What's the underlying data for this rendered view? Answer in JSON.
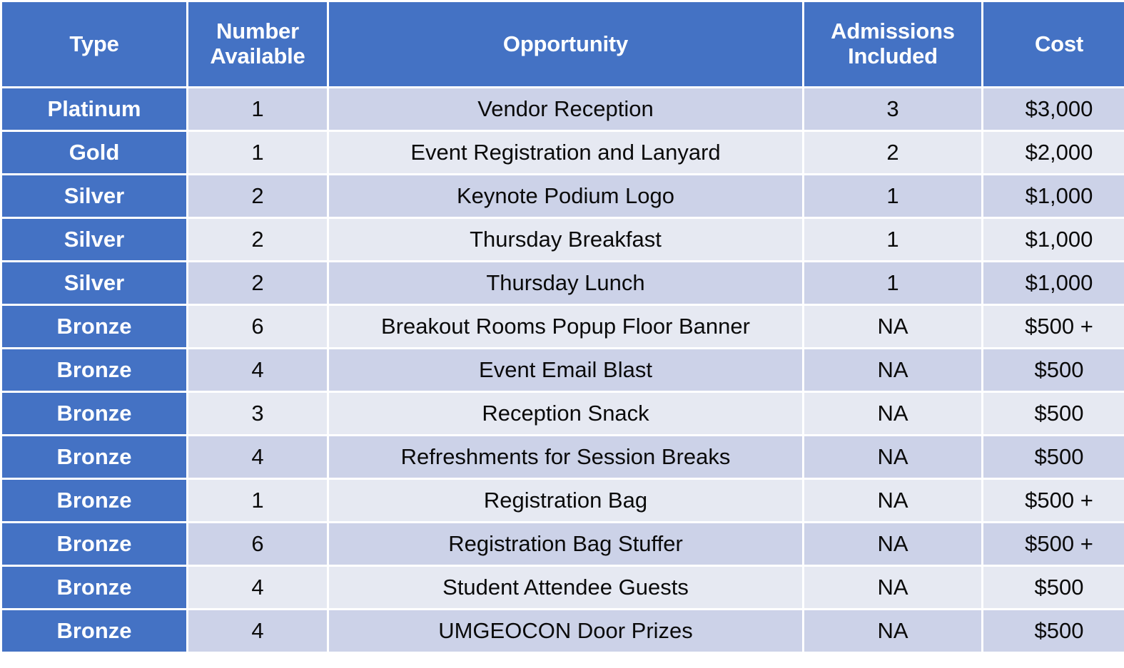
{
  "table": {
    "name": "sponsorship-opportunities-table",
    "colors": {
      "header_background": "#4472C4",
      "header_text": "#FFFFFF",
      "row_dark": "#CCD2E8",
      "row_light": "#E6E9F2",
      "type_cell_background": "#4472C4",
      "type_cell_text": "#FFFFFF",
      "body_text": "#0A0A0A"
    },
    "columns": [
      {
        "key": "type",
        "label": "Type"
      },
      {
        "key": "number",
        "label": "Number Available"
      },
      {
        "key": "opportunity",
        "label": "Opportunity"
      },
      {
        "key": "admissions",
        "label": "Admissions Included"
      },
      {
        "key": "cost",
        "label": "Cost"
      }
    ],
    "headers": {
      "type": "Type",
      "number_line1": "Number",
      "number_line2": "Available",
      "opportunity": "Opportunity",
      "admissions_line1": "Admissions",
      "admissions_line2": "Included",
      "cost": "Cost"
    },
    "rows": [
      {
        "type": "Platinum",
        "number": "1",
        "opportunity": "Vendor Reception",
        "admissions": "3",
        "cost": "$3,000"
      },
      {
        "type": "Gold",
        "number": "1",
        "opportunity": "Event Registration and Lanyard",
        "admissions": "2",
        "cost": "$2,000"
      },
      {
        "type": "Silver",
        "number": "2",
        "opportunity": "Keynote Podium Logo",
        "admissions": "1",
        "cost": "$1,000"
      },
      {
        "type": "Silver",
        "number": "2",
        "opportunity": "Thursday Breakfast",
        "admissions": "1",
        "cost": "$1,000"
      },
      {
        "type": "Silver",
        "number": "2",
        "opportunity": "Thursday Lunch",
        "admissions": "1",
        "cost": "$1,000"
      },
      {
        "type": "Bronze",
        "number": "6",
        "opportunity": "Breakout Rooms Popup Floor Banner",
        "admissions": "NA",
        "cost": "$500 +"
      },
      {
        "type": "Bronze",
        "number": "4",
        "opportunity": "Event Email Blast",
        "admissions": "NA",
        "cost": "$500"
      },
      {
        "type": "Bronze",
        "number": "3",
        "opportunity": "Reception Snack",
        "admissions": "NA",
        "cost": "$500"
      },
      {
        "type": "Bronze",
        "number": "4",
        "opportunity": "Refreshments for Session Breaks",
        "admissions": "NA",
        "cost": "$500"
      },
      {
        "type": "Bronze",
        "number": "1",
        "opportunity": "Registration Bag",
        "admissions": "NA",
        "cost": "$500 +"
      },
      {
        "type": "Bronze",
        "number": "6",
        "opportunity": "Registration Bag Stuffer",
        "admissions": "NA",
        "cost": "$500 +"
      },
      {
        "type": "Bronze",
        "number": "4",
        "opportunity": "Student Attendee Guests",
        "admissions": "NA",
        "cost": "$500"
      },
      {
        "type": "Bronze",
        "number": "4",
        "opportunity": "UMGEOCON Door Prizes",
        "admissions": "NA",
        "cost": "$500"
      }
    ]
  }
}
